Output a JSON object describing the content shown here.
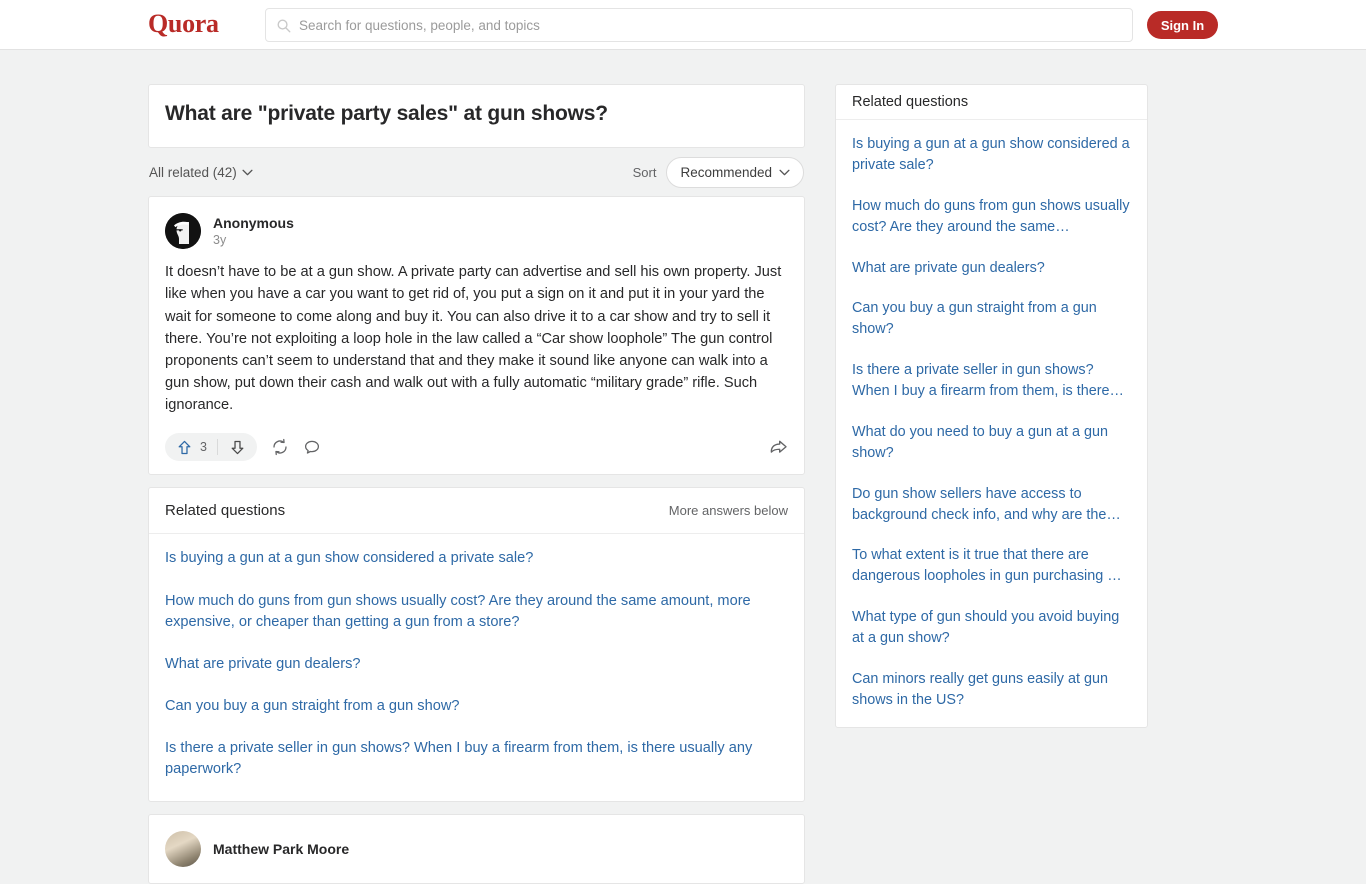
{
  "header": {
    "logo": "Quora",
    "search": {
      "placeholder": "Search for questions, people, and topics",
      "value": ""
    },
    "sign_in_label": "Sign In",
    "icons": {
      "search": "search-icon"
    },
    "brand_color": "#b92b27"
  },
  "question": {
    "title": "What are \"private party sales\" at gun shows?",
    "filter_label": "All related (42)",
    "sort_label": "Sort",
    "sort_value": "Recommended"
  },
  "answer": {
    "author": "Anonymous",
    "time": "3y",
    "avatar": "anonymous-avatar",
    "body": "It doesn’t have to be at a gun show. A private party can advertise and sell his own property. Just like when you have a car you want to get rid of, you put a sign on it and put it in your yard the wait for someone to come along and buy it. You can also drive it to a car show and try to sell it there. You’re not exploiting a loop hole in the law called a “Car show loophole” The gun control proponents can’t seem to understand that and they make it sound like anyone can walk into a gun show, put down their cash and walk out with a fully automatic “military grade” rifle. Such ignorance.",
    "upvote_count": "3",
    "actions": [
      "upvote-icon",
      "downvote-icon",
      "repost-icon",
      "comment-icon",
      "share-icon"
    ],
    "upvote_color": "#2e69a6"
  },
  "related_main": {
    "title": "Related questions",
    "more_label": "More answers below",
    "items": [
      "Is buying a gun at a gun show considered a private sale?",
      "How much do guns from gun shows usually cost? Are they around the same amount, more expensive, or cheaper than getting a gun from a store?",
      "What are private gun dealers?",
      "Can you buy a gun straight from a gun show?",
      "Is there a private seller in gun shows? When I buy a firearm from them, is there usually any paperwork?"
    ]
  },
  "related_aside": {
    "title": "Related questions",
    "items": [
      "Is buying a gun at a gun show considered a private sale?",
      "How much do guns from gun shows usually cost? Are they around the same…",
      "What are private gun dealers?",
      "Can you buy a gun straight from a gun show?",
      "Is there a private seller in gun shows? When I buy a firearm from them, is there…",
      "What do you need to buy a gun at a gun show?",
      "Do gun show sellers have access to background check info, and why are the…",
      "To what extent is it true that there are dangerous loopholes in gun purchasing …",
      "What type of gun should you avoid buying at a gun show?",
      "Can minors really get guns easily at gun shows in the US?"
    ]
  },
  "next_answer": {
    "author": "Matthew Park Moore"
  }
}
